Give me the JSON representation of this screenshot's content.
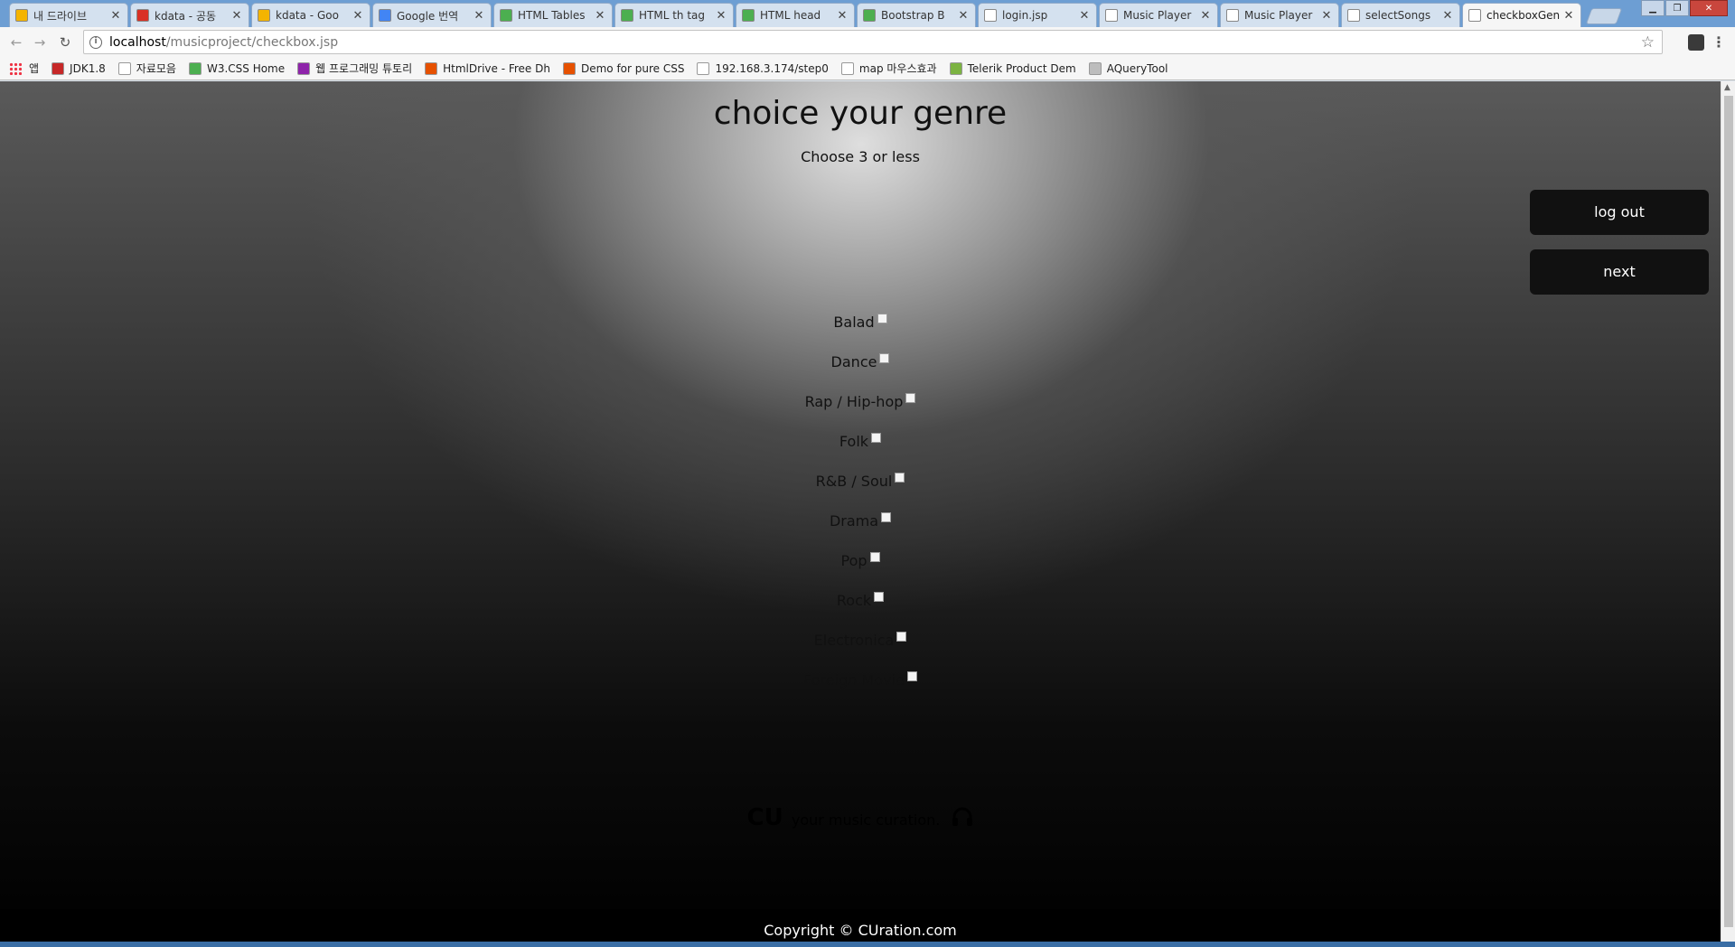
{
  "browser": {
    "tabs": [
      {
        "title": "내 드라이브",
        "favicon_color": "#f4b400"
      },
      {
        "title": "kdata - 공동",
        "favicon_color": "#d93025"
      },
      {
        "title": "kdata - Goo",
        "favicon_color": "#f4b400"
      },
      {
        "title": "Google 번역",
        "favicon_color": "#4285f4"
      },
      {
        "title": "HTML Tables",
        "favicon_color": "#4caf50"
      },
      {
        "title": "HTML th tag",
        "favicon_color": "#4caf50"
      },
      {
        "title": "HTML head",
        "favicon_color": "#4caf50"
      },
      {
        "title": "Bootstrap B",
        "favicon_color": "#4caf50"
      },
      {
        "title": "login.jsp",
        "favicon_color": "#ffffff"
      },
      {
        "title": "Music Player",
        "favicon_color": "#ffffff"
      },
      {
        "title": "Music Player",
        "favicon_color": "#ffffff"
      },
      {
        "title": "selectSongs",
        "favicon_color": "#ffffff"
      },
      {
        "title": "checkboxGen",
        "favicon_color": "#ffffff",
        "active": true
      }
    ],
    "address": {
      "host": "localhost",
      "path": "/musicproject/checkbox.jsp"
    },
    "bookmarks": [
      {
        "label": "앱",
        "icon": "apps-icon"
      },
      {
        "label": "JDK1.8",
        "icon_color": "#c62828"
      },
      {
        "label": "자료모음",
        "icon_color": "#ffffff"
      },
      {
        "label": "W3.CSS Home",
        "icon_color": "#4caf50"
      },
      {
        "label": "웹 프로그래밍 튜토리",
        "icon_color": "#8e24aa"
      },
      {
        "label": "HtmlDrive - Free Dh",
        "icon_color": "#e65100"
      },
      {
        "label": "Demo for pure CSS",
        "icon_color": "#e65100"
      },
      {
        "label": "192.168.3.174/step0",
        "icon_color": "#ffffff"
      },
      {
        "label": "map 마우스효과",
        "icon_color": "#ffffff"
      },
      {
        "label": "Telerik Product Dem",
        "icon_color": "#7cb342"
      },
      {
        "label": "AQueryTool",
        "icon_color": "#bdbdbd"
      }
    ]
  },
  "page": {
    "title": "choice your genre",
    "subtitle": "Choose 3 or less",
    "logout_label": "log out",
    "next_label": "next",
    "genres": [
      {
        "label": "Balad",
        "checked": false
      },
      {
        "label": "Dance",
        "checked": false
      },
      {
        "label": "Rap / Hip-hop",
        "checked": false
      },
      {
        "label": "Folk",
        "checked": false
      },
      {
        "label": "R&B / Soul",
        "checked": false
      },
      {
        "label": "Drama",
        "checked": false
      },
      {
        "label": "Pop",
        "checked": false
      },
      {
        "label": "Rock",
        "checked": false
      },
      {
        "label": "Electronica",
        "checked": false
      },
      {
        "label": "Foreign Movie",
        "checked": false
      }
    ],
    "brand": {
      "name": "CU",
      "tagline": "your music curation."
    },
    "footer": "Copyright © CUration.com"
  }
}
